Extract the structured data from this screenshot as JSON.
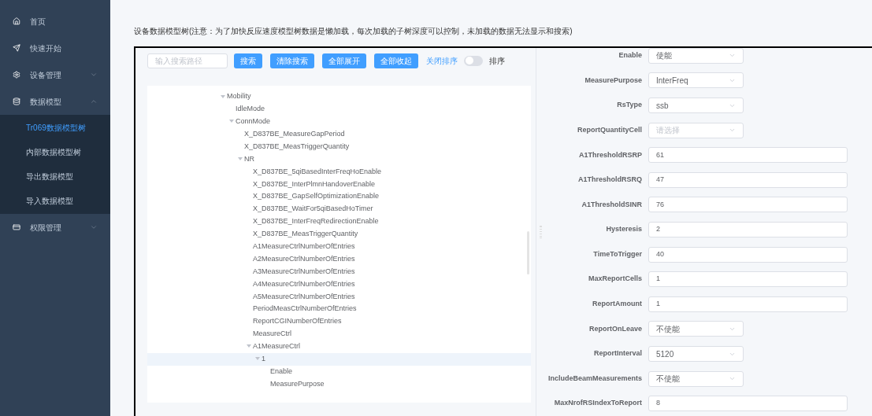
{
  "sidebar": {
    "items": [
      {
        "label": "首页"
      },
      {
        "label": "快速开始"
      },
      {
        "label": "设备管理",
        "expanded": false
      },
      {
        "label": "数据模型",
        "expanded": true,
        "children": [
          {
            "label": "Tr069数据模型树",
            "selected": true
          },
          {
            "label": "内部数据模型树",
            "selected": false
          },
          {
            "label": "导出数据模型",
            "selected": false
          },
          {
            "label": "导入数据模型",
            "selected": false
          }
        ]
      },
      {
        "label": "权限管理",
        "expanded": false
      }
    ]
  },
  "page_title": "设备数据模型树(注意：为了加快反应速度模型树数据是懒加载，每次加载的子树深度可以控制，未加载的数据无法显示和搜索)",
  "toolbar": {
    "search": {
      "placeholder": "输入搜索路径"
    },
    "buttons": [
      "搜索",
      "清除搜索",
      "全部展开",
      "全部收起"
    ],
    "sort_off_label": "关闭排序",
    "sort_switch": {
      "on": false
    },
    "sort_on_label": "排序"
  },
  "tree": [
    {
      "label": "Mobility",
      "expanded": true,
      "selected": false,
      "children": [
        {
          "label": "IdleMode",
          "selected": false
        },
        {
          "label": "ConnMode",
          "expanded": true,
          "selected": false,
          "children": [
            {
              "label": "X_D837BE_MeasureGapPeriod",
              "selected": false
            },
            {
              "label": "X_D837BE_MeasTriggerQuantity",
              "selected": false
            },
            {
              "label": "NR",
              "expanded": true,
              "selected": false,
              "children": [
                {
                  "label": "X_D837BE_5qiBasedInterFreqHoEnable",
                  "selected": false
                },
                {
                  "label": "X_D837BE_InterPlmnHandoverEnable",
                  "selected": false
                },
                {
                  "label": "X_D837BE_GapSelfOptimizationEnable",
                  "selected": false
                },
                {
                  "label": "X_D837BE_WaitFor5qiBasedHoTimer",
                  "selected": false
                },
                {
                  "label": "X_D837BE_InterFreqRedirectionEnable",
                  "selected": false
                },
                {
                  "label": "X_D837BE_MeasTriggerQuantity",
                  "selected": false
                },
                {
                  "label": "A1MeasureCtrlNumberOfEntries",
                  "selected": false
                },
                {
                  "label": "A2MeasureCtrlNumberOfEntries",
                  "selected": false
                },
                {
                  "label": "A3MeasureCtrlNumberOfEntries",
                  "selected": false
                },
                {
                  "label": "A4MeasureCtrlNumberOfEntries",
                  "selected": false
                },
                {
                  "label": "A5MeasureCtrlNumberOfEntries",
                  "selected": false
                },
                {
                  "label": "PeriodMeasCtrlNumberOfEntries",
                  "selected": false
                },
                {
                  "label": "ReportCGINumberOfEntries",
                  "selected": false
                },
                {
                  "label": "MeasureCtrl",
                  "selected": false
                },
                {
                  "label": "A1MeasureCtrl",
                  "expanded": true,
                  "selected": false,
                  "children": [
                    {
                      "label": "1",
                      "expanded": true,
                      "selected": true,
                      "children": [
                        {
                          "label": "Enable",
                          "selected": false
                        },
                        {
                          "label": "MeasurePurpose",
                          "selected": false
                        }
                      ]
                    }
                  ]
                }
              ]
            }
          ]
        }
      ]
    }
  ],
  "form": [
    {
      "label": "Enable",
      "kind": "select",
      "value": "使能"
    },
    {
      "label": "MeasurePurpose",
      "kind": "select",
      "value": "InterFreq"
    },
    {
      "label": "RsType",
      "kind": "select",
      "value": "ssb"
    },
    {
      "label": "ReportQuantityCell",
      "kind": "select",
      "placeholder": "请选择"
    },
    {
      "label": "A1ThresholdRSRP",
      "kind": "input",
      "value": "61"
    },
    {
      "label": "A1ThresholdRSRQ",
      "kind": "input",
      "value": "47"
    },
    {
      "label": "A1ThresholdSINR",
      "kind": "input",
      "value": "76"
    },
    {
      "label": "Hysteresis",
      "kind": "input",
      "value": "2"
    },
    {
      "label": "TimeToTrigger",
      "kind": "input",
      "value": "40"
    },
    {
      "label": "MaxReportCells",
      "kind": "input",
      "value": "1"
    },
    {
      "label": "ReportAmount",
      "kind": "input",
      "value": "1"
    },
    {
      "label": "ReportOnLeave",
      "kind": "select",
      "value": "不使能"
    },
    {
      "label": "ReportInterval",
      "kind": "select",
      "value": "5120"
    },
    {
      "label": "IncludeBeamMeasurements",
      "kind": "select",
      "value": "不使能"
    },
    {
      "label": "MaxNrofRSIndexToReport",
      "kind": "input",
      "value": "8"
    }
  ]
}
